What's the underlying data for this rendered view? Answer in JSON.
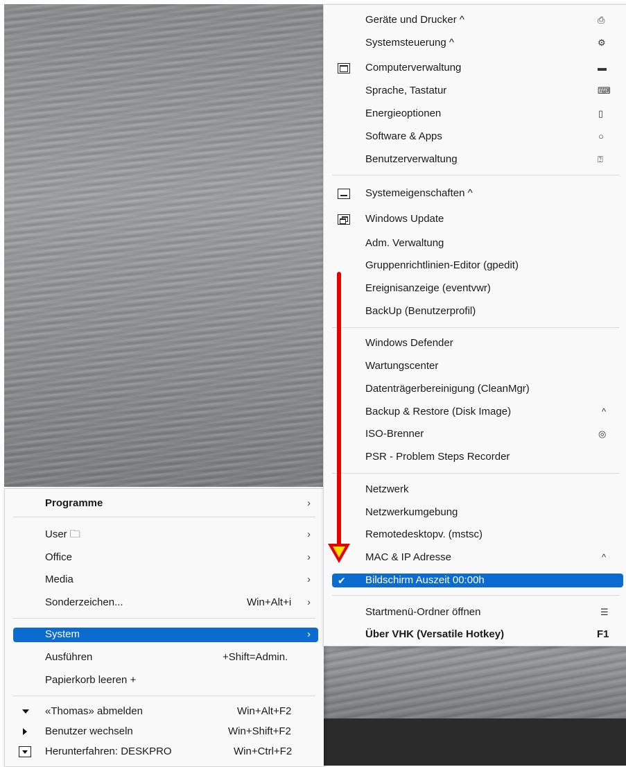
{
  "left_menu": {
    "items": [
      {
        "label": "Programme",
        "submenu": "›"
      },
      {
        "label": "User 🗀",
        "submenu": "›"
      },
      {
        "label": "Office",
        "submenu": "›"
      },
      {
        "label": "Media",
        "submenu": "›"
      },
      {
        "label": "Sonderzeichen...",
        "accel": "Win+Alt+i",
        "submenu": "›"
      },
      {
        "label": "System",
        "submenu": "›"
      },
      {
        "label": "Ausführen",
        "accel": "+Shift=Admin."
      },
      {
        "label": "Papierkorb leeren +"
      },
      {
        "label": "«Thomas» abmelden",
        "accel": "Win+Alt+F2",
        "icon": "triangle-down-icon"
      },
      {
        "label": "Benutzer wechseln",
        "accel": "Win+Shift+F2",
        "icon": "triangle-right-icon"
      },
      {
        "label": "Herunterfahren: DESKPRO",
        "accel": "Win+Ctrl+F2",
        "icon": "dropdown-box-icon"
      }
    ]
  },
  "right_menu": {
    "items": [
      {
        "label": "Geräte und Drucker ^",
        "icon": "printer-icon",
        "icon_glyph": "⎙"
      },
      {
        "label": "Systemsteuerung ^",
        "icon": "gear-icon",
        "icon_glyph": "⚙"
      },
      {
        "label": "Computerverwaltung",
        "icon": "computer-icon",
        "icon_glyph": "▬",
        "left_icon": "window-box-icon"
      },
      {
        "label": "Sprache, Tastatur",
        "icon": "keyboard-icon",
        "icon_glyph": "⌨"
      },
      {
        "label": "Energieoptionen",
        "icon": "battery-icon",
        "icon_glyph": "▯"
      },
      {
        "label": "Software & Apps",
        "icon": "circle-icon",
        "icon_glyph": "○"
      },
      {
        "label": "Benutzerverwaltung",
        "icon": "user-card-icon",
        "icon_glyph": "⍰"
      },
      {
        "label": "Systemeigenschaften ^",
        "left_icon": "minimize-box-icon"
      },
      {
        "label": "Windows Update",
        "left_icon": "restore-box-icon"
      },
      {
        "label": "Adm. Verwaltung"
      },
      {
        "label": "Gruppenrichtlinien-Editor (gpedit)"
      },
      {
        "label": "Ereignisanzeige (eventvwr)"
      },
      {
        "label": "BackUp (Benutzerprofil)"
      },
      {
        "label": "Windows Defender"
      },
      {
        "label": "Wartungscenter"
      },
      {
        "label": "Datenträgerbereinigung (CleanMgr)"
      },
      {
        "label": "Backup & Restore (Disk Image)",
        "right_text": "^"
      },
      {
        "label": "ISO-Brenner",
        "icon": "disc-icon",
        "icon_glyph": "◎"
      },
      {
        "label": "PSR - Problem Steps Recorder"
      },
      {
        "label": "Netzwerk"
      },
      {
        "label": "Netzwerkumgebung"
      },
      {
        "label": "Remotedesktopv. (mstsc)"
      },
      {
        "label": "MAC & IP Adresse",
        "right_text": "^"
      },
      {
        "label": "Bildschirm Auszeit 00:00h",
        "checked": "✔"
      },
      {
        "label": "Startmenü-Ordner öffnen",
        "icon": "menu-lines-icon",
        "icon_glyph": "☰"
      },
      {
        "label": "Über VHK (Versatile Hotkey)",
        "accel": "F1"
      }
    ]
  }
}
